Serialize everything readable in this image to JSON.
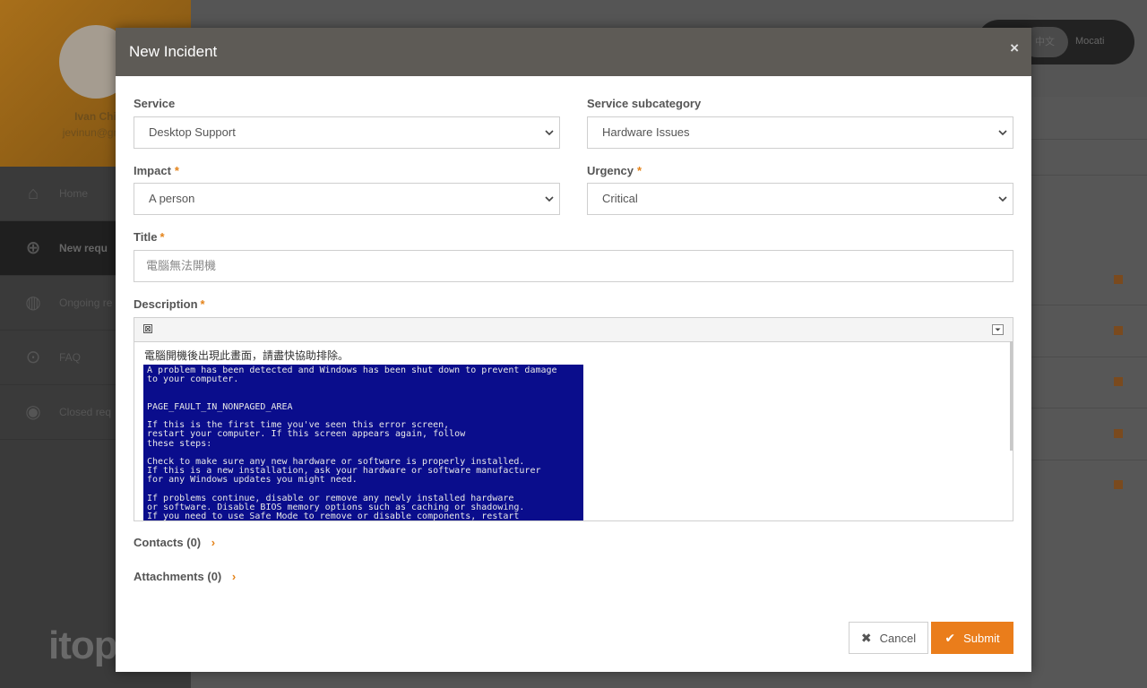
{
  "background": {
    "user_name": "Ivan Chi",
    "user_email": "jevinun@gma",
    "menu": [
      {
        "icon": "home-icon",
        "label": "Home"
      },
      {
        "icon": "plus-circle-icon",
        "label": "New requ"
      },
      {
        "icon": "ongoing-icon",
        "label": "Ongoing re"
      },
      {
        "icon": "faq-icon",
        "label": "FAQ"
      },
      {
        "icon": "closed-icon",
        "label": "Closed req"
      }
    ],
    "logo": "itop",
    "lang_left": "中文",
    "lang_right": "Mocati"
  },
  "modal": {
    "title": "New Incident",
    "close": "×",
    "service": {
      "label": "Service",
      "value": "Desktop Support"
    },
    "subcategory": {
      "label": "Service subcategory",
      "value": "Hardware Issues"
    },
    "impact": {
      "label": "Impact",
      "required": "*",
      "value": "A person"
    },
    "urgency": {
      "label": "Urgency",
      "required": "*",
      "value": "Critical"
    },
    "title_field": {
      "label": "Title",
      "required": "*",
      "value": "電腦無法開機"
    },
    "description": {
      "label": "Description",
      "required": "*",
      "toolbar_button": "⊠",
      "text": "電腦開機後出現此畫面，請盡快協助排除。",
      "screenshot_lines": [
        "A problem has been detected and Windows has been shut down to prevent damage",
        "to your computer.",
        "",
        "",
        "PAGE_FAULT_IN_NONPAGED_AREA",
        "",
        "If this is the first time you've seen this error screen,",
        "restart your computer. If this screen appears again, follow",
        "these steps:",
        "",
        "Check to make sure any new hardware or software is properly installed.",
        "If this is a new installation, ask your hardware or software manufacturer",
        "for any Windows updates you might need.",
        "",
        "If problems continue, disable or remove any newly installed hardware",
        "or software. Disable BIOS memory options such as caching or shadowing.",
        "If you need to use Safe Mode to remove or disable components, restart"
      ]
    },
    "contacts": {
      "label": "Contacts",
      "count": "(0)"
    },
    "attachments": {
      "label": "Attachments",
      "count": "(0)"
    },
    "cancel_label": "Cancel",
    "submit_label": "Submit"
  },
  "colors": {
    "accent": "#ea7d1b",
    "header": "#5e5b56",
    "bsod": "#0a0d8c"
  }
}
